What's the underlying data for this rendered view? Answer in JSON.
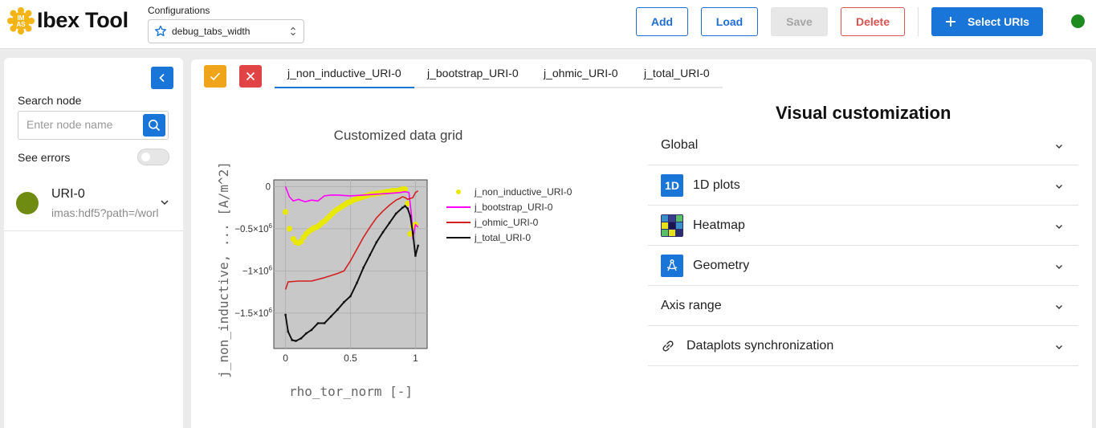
{
  "header": {
    "app_title": "Ibex Tool",
    "logo_letters": "IMAS",
    "config_label": "Configurations",
    "config_value": "debug_tabs_width",
    "add_label": "Add",
    "load_label": "Load",
    "save_label": "Save",
    "delete_label": "Delete",
    "select_uris_label": "Select URIs",
    "status_color": "#1e8b1e"
  },
  "sidebar": {
    "search_label": "Search node",
    "search_placeholder": "Enter node name",
    "errors_label": "See errors",
    "see_errors_on": false,
    "uri": {
      "name": "URI-0",
      "path": "imas:hdf5?path=/worl",
      "color": "#6f8b12"
    }
  },
  "main": {
    "tabs": [
      {
        "label": "j_non_inductive_URI-0",
        "active": true
      },
      {
        "label": "j_bootstrap_URI-0",
        "active": false
      },
      {
        "label": "j_ohmic_URI-0",
        "active": false
      },
      {
        "label": "j_total_URI-0",
        "active": false
      }
    ]
  },
  "customization": {
    "title": "Visual customization",
    "items": [
      {
        "label": "Global",
        "icon": ""
      },
      {
        "label": "1D plots",
        "icon": "1D"
      },
      {
        "label": "Heatmap",
        "icon": "heatmap-icon"
      },
      {
        "label": "Geometry",
        "icon": "geometry-icon"
      },
      {
        "label": "Axis range",
        "icon": ""
      },
      {
        "label": "Dataplots synchronization",
        "icon": "link-icon"
      }
    ]
  },
  "chart_data": {
    "type": "line",
    "title": "Customized data grid",
    "xlabel": "rho_tor_norm [-]",
    "ylabel": "j_non_inductive, ... [A/m^2]",
    "xlim": [
      -0.09,
      1.09
    ],
    "ylim": [
      -1.92,
      0.08
    ],
    "ytick_unit": "×10^6",
    "xticks": [
      {
        "v": 0,
        "label": "0"
      },
      {
        "v": 0.5,
        "label": "0.5"
      },
      {
        "v": 1,
        "label": "1"
      }
    ],
    "yticks": [
      {
        "v": 0,
        "label": "0",
        "exp": ""
      },
      {
        "v": -0.5,
        "label": "−0.5×10",
        "exp": "6"
      },
      {
        "v": -1,
        "label": "−1×10",
        "exp": "6"
      },
      {
        "v": -1.5,
        "label": "−1.5×10",
        "exp": "6"
      }
    ],
    "plot_bg": "#c8c8c8",
    "legend_position": "right",
    "series": [
      {
        "name": "j_non_inductive_URI-0",
        "color": "#e8e800",
        "style": "markers",
        "x": [
          0.0,
          0.03,
          0.06,
          0.08,
          0.1,
          0.12,
          0.14,
          0.16,
          0.18,
          0.2,
          0.22,
          0.24,
          0.26,
          0.28,
          0.3,
          0.32,
          0.34,
          0.36,
          0.38,
          0.4,
          0.42,
          0.44,
          0.46,
          0.48,
          0.5,
          0.52,
          0.54,
          0.56,
          0.58,
          0.6,
          0.62,
          0.64,
          0.66,
          0.68,
          0.7,
          0.72,
          0.74,
          0.76,
          0.78,
          0.8,
          0.82,
          0.84,
          0.86,
          0.88,
          0.9,
          0.92,
          0.94,
          0.96,
          0.98,
          1.0
        ],
        "y": [
          -0.3,
          -0.5,
          -0.62,
          -0.66,
          -0.67,
          -0.65,
          -0.6,
          -0.56,
          -0.53,
          -0.51,
          -0.49,
          -0.48,
          -0.46,
          -0.43,
          -0.41,
          -0.38,
          -0.35,
          -0.32,
          -0.29,
          -0.27,
          -0.25,
          -0.23,
          -0.21,
          -0.19,
          -0.18,
          -0.16,
          -0.15,
          -0.14,
          -0.13,
          -0.12,
          -0.11,
          -0.1,
          -0.09,
          -0.09,
          -0.08,
          -0.08,
          -0.07,
          -0.07,
          -0.06,
          -0.06,
          -0.05,
          -0.05,
          -0.05,
          -0.04,
          -0.03,
          -0.03,
          -0.2,
          -0.56,
          -0.47,
          -0.45
        ]
      },
      {
        "name": "j_bootstrap_URI-0",
        "color": "#ff00ff",
        "style": "line",
        "x": [
          0.0,
          0.03,
          0.06,
          0.1,
          0.15,
          0.2,
          0.25,
          0.3,
          0.35,
          0.4,
          0.5,
          0.6,
          0.7,
          0.8,
          0.88,
          0.92,
          0.95,
          0.97,
          0.98,
          1.0,
          1.02
        ],
        "y": [
          0.0,
          -0.12,
          -0.17,
          -0.15,
          -0.18,
          -0.16,
          -0.17,
          -0.11,
          -0.1,
          -0.1,
          -0.11,
          -0.1,
          -0.09,
          -0.08,
          -0.07,
          -0.06,
          -0.07,
          -0.35,
          -0.62,
          -0.45,
          -0.48
        ]
      },
      {
        "name": "j_ohmic_URI-0",
        "color": "#d42020",
        "style": "line",
        "x": [
          0.0,
          0.02,
          0.1,
          0.2,
          0.3,
          0.4,
          0.45,
          0.5,
          0.55,
          0.6,
          0.65,
          0.7,
          0.75,
          0.8,
          0.85,
          0.88,
          0.9,
          0.92,
          0.94,
          0.96,
          0.98,
          1.0,
          1.02
        ],
        "y": [
          -1.22,
          -1.13,
          -1.12,
          -1.12,
          -1.08,
          -1.03,
          -1.0,
          -0.88,
          -0.74,
          -0.6,
          -0.48,
          -0.37,
          -0.29,
          -0.22,
          -0.16,
          -0.14,
          -0.12,
          -0.13,
          -0.15,
          -0.14,
          -0.13,
          -0.07,
          -0.05
        ]
      },
      {
        "name": "j_total_URI-0",
        "color": "#111111",
        "style": "line-steps",
        "x": [
          0.0,
          0.02,
          0.05,
          0.08,
          0.12,
          0.16,
          0.2,
          0.25,
          0.3,
          0.35,
          0.4,
          0.45,
          0.5,
          0.55,
          0.6,
          0.65,
          0.7,
          0.75,
          0.8,
          0.85,
          0.9,
          0.92,
          0.94,
          0.96,
          0.98,
          1.0,
          1.02
        ],
        "y": [
          -1.52,
          -1.72,
          -1.82,
          -1.83,
          -1.8,
          -1.74,
          -1.7,
          -1.62,
          -1.62,
          -1.54,
          -1.46,
          -1.37,
          -1.3,
          -1.14,
          -0.96,
          -0.81,
          -0.66,
          -0.54,
          -0.43,
          -0.32,
          -0.25,
          -0.23,
          -0.26,
          -0.35,
          -0.55,
          -0.82,
          -0.7
        ]
      }
    ]
  }
}
